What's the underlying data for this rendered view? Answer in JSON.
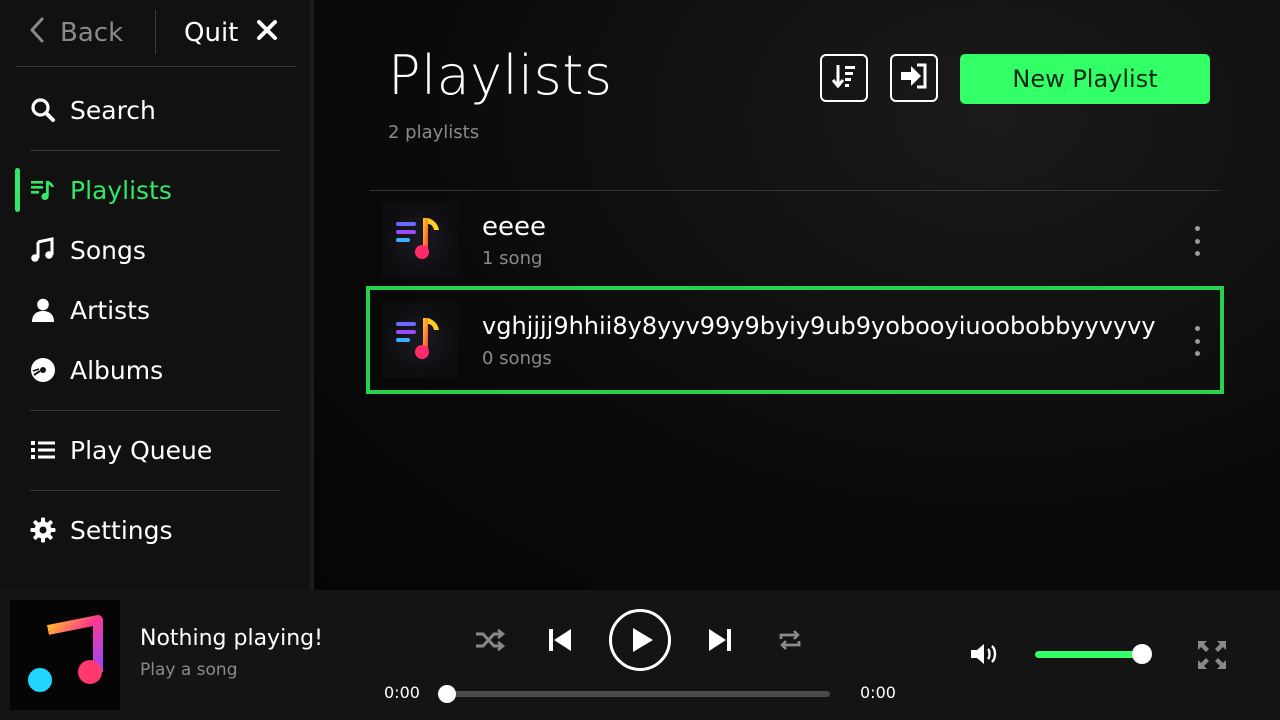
{
  "topnav": {
    "back_label": "Back",
    "quit_label": "Quit"
  },
  "sidebar": {
    "items": [
      {
        "label": "Search",
        "icon": "search-icon"
      },
      {
        "label": "Playlists",
        "icon": "playlist-music-icon",
        "active": true
      },
      {
        "label": "Songs",
        "icon": "music-note-icon"
      },
      {
        "label": "Artists",
        "icon": "person-icon"
      },
      {
        "label": "Albums",
        "icon": "disc-icon"
      },
      {
        "label": "Play Queue",
        "icon": "list-icon"
      },
      {
        "label": "Settings",
        "icon": "gear-icon"
      }
    ]
  },
  "header": {
    "title": "Playlists",
    "subtitle": "2 playlists",
    "new_playlist_label": "New Playlist",
    "sort_icon": "sort-icon",
    "import_icon": "import-icon"
  },
  "playlists": [
    {
      "name": "eeee",
      "count": "1 song"
    },
    {
      "name": "vghjjjj9hhii8y8yyv99y9byiy9ub9yobooyiuoobobbyyvyvy",
      "count": "0 songs",
      "selected": true
    }
  ],
  "player": {
    "title": "Nothing playing!",
    "subtitle": "Play a song",
    "elapsed": "0:00",
    "duration": "0:00",
    "progress": 0,
    "volume": 1.0
  },
  "colors": {
    "accent": "#33e868",
    "button_green": "#33ff66",
    "selection_outline": "#27d04f",
    "sidebar_bg": "#111111",
    "player_bg": "#141414"
  }
}
